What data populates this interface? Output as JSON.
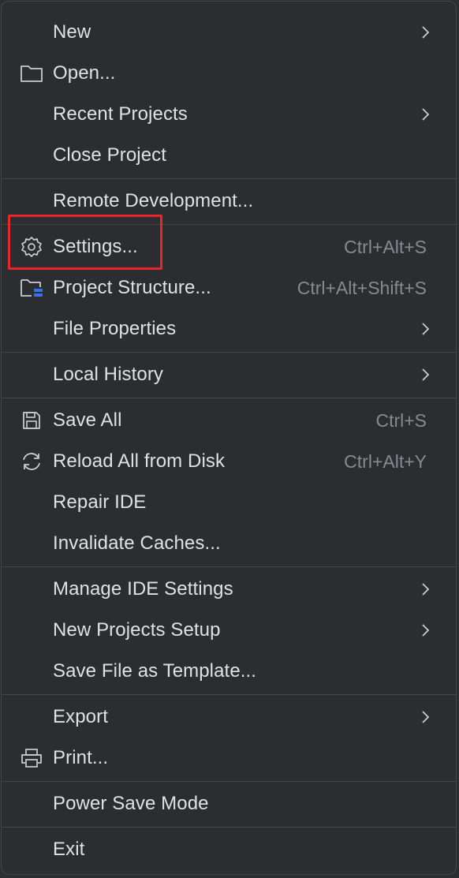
{
  "menu": {
    "items": [
      {
        "label": "New",
        "shortcut": "",
        "submenu": true,
        "icon": ""
      },
      {
        "label": "Open...",
        "shortcut": "",
        "submenu": false,
        "icon": "folder-icon"
      },
      {
        "label": "Recent Projects",
        "shortcut": "",
        "submenu": true,
        "icon": ""
      },
      {
        "label": "Close Project",
        "shortcut": "",
        "submenu": false,
        "icon": ""
      },
      {
        "label": "Remote Development...",
        "shortcut": "",
        "submenu": false,
        "icon": ""
      },
      {
        "label": "Settings...",
        "shortcut": "Ctrl+Alt+S",
        "submenu": false,
        "icon": "gear-icon"
      },
      {
        "label": "Project Structure...",
        "shortcut": "Ctrl+Alt+Shift+S",
        "submenu": false,
        "icon": "project-structure-icon"
      },
      {
        "label": "File Properties",
        "shortcut": "",
        "submenu": true,
        "icon": ""
      },
      {
        "label": "Local History",
        "shortcut": "",
        "submenu": true,
        "icon": ""
      },
      {
        "label": "Save All",
        "shortcut": "Ctrl+S",
        "submenu": false,
        "icon": "save-icon"
      },
      {
        "label": "Reload All from Disk",
        "shortcut": "Ctrl+Alt+Y",
        "submenu": false,
        "icon": "reload-icon"
      },
      {
        "label": "Repair IDE",
        "shortcut": "",
        "submenu": false,
        "icon": ""
      },
      {
        "label": "Invalidate Caches...",
        "shortcut": "",
        "submenu": false,
        "icon": ""
      },
      {
        "label": "Manage IDE Settings",
        "shortcut": "",
        "submenu": true,
        "icon": ""
      },
      {
        "label": "New Projects Setup",
        "shortcut": "",
        "submenu": true,
        "icon": ""
      },
      {
        "label": "Save File as Template...",
        "shortcut": "",
        "submenu": false,
        "icon": ""
      },
      {
        "label": "Export",
        "shortcut": "",
        "submenu": true,
        "icon": ""
      },
      {
        "label": "Print...",
        "shortcut": "",
        "submenu": false,
        "icon": "printer-icon"
      },
      {
        "label": "Power Save Mode",
        "shortcut": "",
        "submenu": false,
        "icon": ""
      },
      {
        "label": "Exit",
        "shortcut": "",
        "submenu": false,
        "icon": ""
      }
    ]
  },
  "colors": {
    "background": "#2b2d30",
    "text": "#dfe1e5",
    "shortcut": "#868a91",
    "separator": "#43454a",
    "highlight_box": "#e8262a",
    "accent_blue": "#3574f0"
  }
}
